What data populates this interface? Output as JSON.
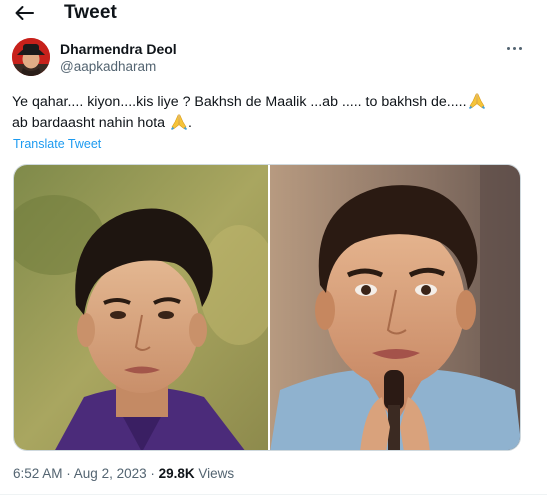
{
  "header": {
    "title": "Tweet",
    "back_icon": "back-arrow-icon"
  },
  "author": {
    "display_name": "Dharmendra Deol",
    "handle": "@aapkadharam",
    "avatar": "user-avatar"
  },
  "tweet": {
    "line1": "Ye qahar.... kiyon....kis liye ? Bakhsh de Maalik ...ab ..... to bakhsh de.....",
    "line2_start": "ab bardaasht nahin hota ",
    "line2_end": ".",
    "emoji": "folded-hands-icon"
  },
  "translate_label": "Translate Tweet",
  "media": {
    "images": [
      "photo-young-man-left",
      "photo-man-holding-microphone-right"
    ]
  },
  "meta": {
    "time": "6:52 AM",
    "separator1": " · ",
    "date": "Aug 2, 2023",
    "separator2": " · ",
    "views_count": "29.8K",
    "views_label": " Views"
  },
  "colors": {
    "accent": "#1d9bf0",
    "secondary_text": "#536471",
    "primary_text": "#0f1419",
    "border": "#cfd9de"
  }
}
